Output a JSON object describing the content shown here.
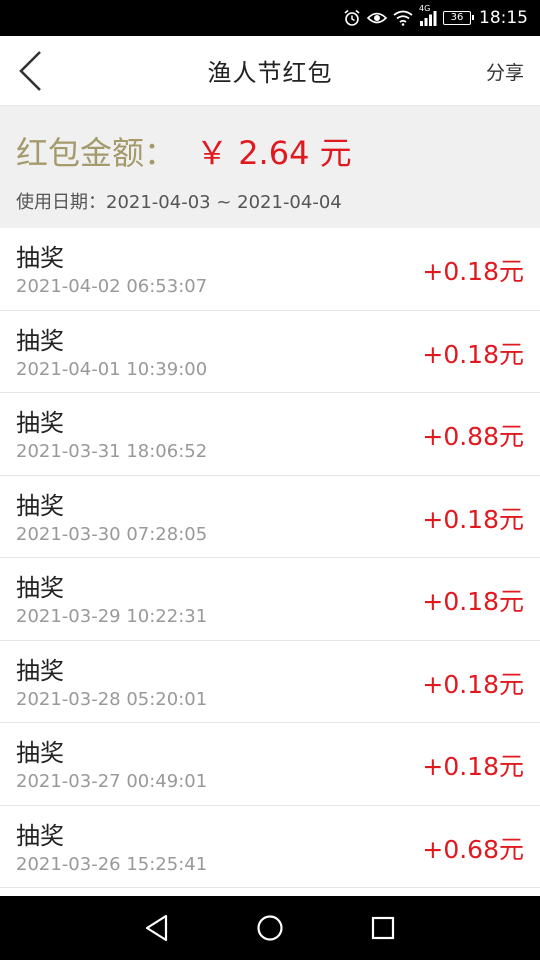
{
  "status_bar": {
    "time": "18:15",
    "battery": "36",
    "network": "4G",
    "icons": [
      "alarm-icon",
      "eye-icon",
      "wifi-icon",
      "signal-icon",
      "battery-icon"
    ]
  },
  "header": {
    "title": "渔人节红包",
    "share_label": "分享",
    "back_icon": "chevron-left-icon"
  },
  "summary": {
    "amount_label": "红包金额：",
    "amount_value": "￥ 2.64 元",
    "date_line": "使用日期：2021-04-03 ~ 2021-04-04",
    "colors": {
      "label": "#a49a6c",
      "amount": "#e0191f"
    }
  },
  "records": [
    {
      "title": "抽奖",
      "time": "2021-04-02 06:53:07",
      "amount": "+0.18元"
    },
    {
      "title": "抽奖",
      "time": "2021-04-01 10:39:00",
      "amount": "+0.18元"
    },
    {
      "title": "抽奖",
      "time": "2021-03-31 18:06:52",
      "amount": "+0.88元"
    },
    {
      "title": "抽奖",
      "time": "2021-03-30 07:28:05",
      "amount": "+0.18元"
    },
    {
      "title": "抽奖",
      "time": "2021-03-29 10:22:31",
      "amount": "+0.18元"
    },
    {
      "title": "抽奖",
      "time": "2021-03-28 05:20:01",
      "amount": "+0.18元"
    },
    {
      "title": "抽奖",
      "time": "2021-03-27 00:49:01",
      "amount": "+0.18元"
    },
    {
      "title": "抽奖",
      "time": "2021-03-26 15:25:41",
      "amount": "+0.68元"
    }
  ],
  "nav_bar": {
    "icons": [
      "back-triangle-icon",
      "home-circle-icon",
      "recents-square-icon"
    ]
  }
}
